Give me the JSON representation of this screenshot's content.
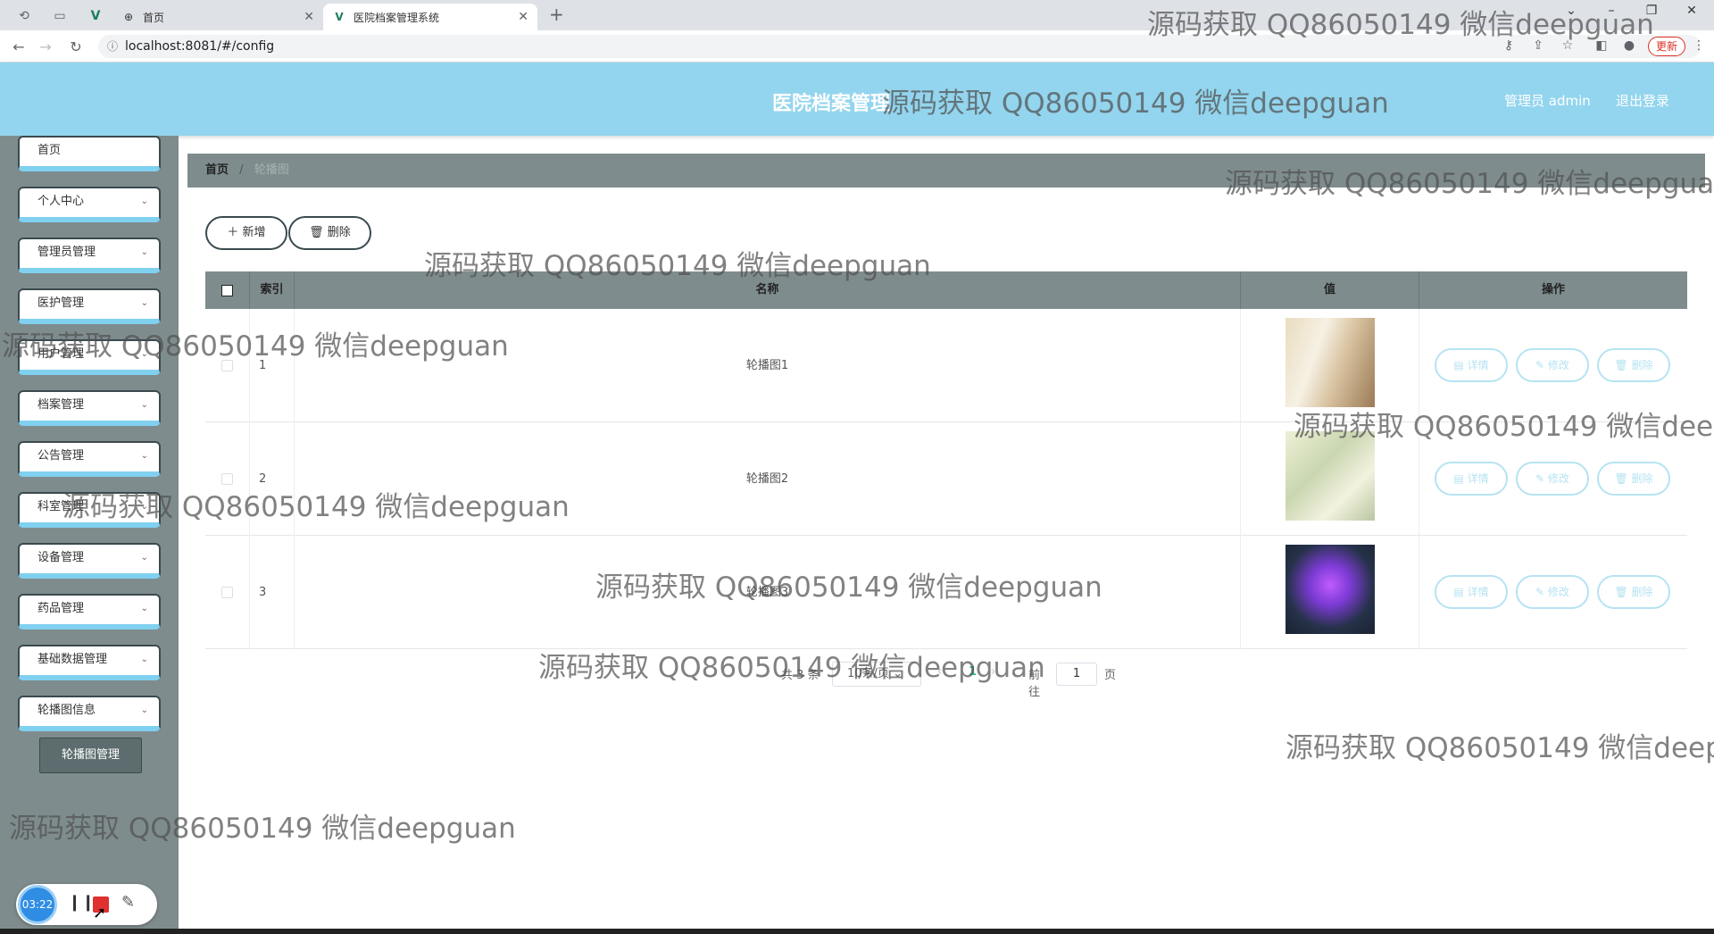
{
  "browser": {
    "tabs": [
      {
        "label": "首页"
      },
      {
        "label": "医院档案管理系统"
      }
    ],
    "url": "localhost:8081/#/config",
    "update_label": "更新"
  },
  "header": {
    "title": "医院档案管理",
    "admin_label": "管理员 admin",
    "logout_label": "退出登录",
    "bg_color": "#93d5ee"
  },
  "sidebar": {
    "items": [
      {
        "label": "首页",
        "has_children": false
      },
      {
        "label": "个人中心",
        "has_children": true
      },
      {
        "label": "管理员管理",
        "has_children": true
      },
      {
        "label": "医护管理",
        "has_children": true
      },
      {
        "label": "用户管理",
        "has_children": true
      },
      {
        "label": "档案管理",
        "has_children": true
      },
      {
        "label": "公告管理",
        "has_children": true
      },
      {
        "label": "科室管理",
        "has_children": true
      },
      {
        "label": "设备管理",
        "has_children": true
      },
      {
        "label": "药品管理",
        "has_children": true
      },
      {
        "label": "基础数据管理",
        "has_children": true
      },
      {
        "label": "轮播图信息",
        "has_children": true
      }
    ],
    "active_subitem": "轮播图管理"
  },
  "breadcrumb": {
    "home": "首页",
    "separator": "/",
    "current": "轮播图"
  },
  "toolbar": {
    "add_label": "＋ 新增",
    "delete_label": "🗑 删除"
  },
  "table": {
    "headers": {
      "index": "索引",
      "name": "名称",
      "value": "值",
      "actions": "操作"
    },
    "rows": [
      {
        "index": "1",
        "name": "轮播图1"
      },
      {
        "index": "2",
        "name": "轮播图2"
      },
      {
        "index": "3",
        "name": "轮播图3"
      }
    ],
    "actions": {
      "detail": "详情",
      "edit": "修改",
      "delete": "删除"
    }
  },
  "pagination": {
    "total": "共 3 条",
    "page_size": "10条/页",
    "current_page": "1",
    "goto_label": "前往",
    "goto_value": "1",
    "page_suffix": "页"
  },
  "recorder": {
    "time": "03:22"
  },
  "watermark": "源码获取 QQ86050149 微信deepguan"
}
